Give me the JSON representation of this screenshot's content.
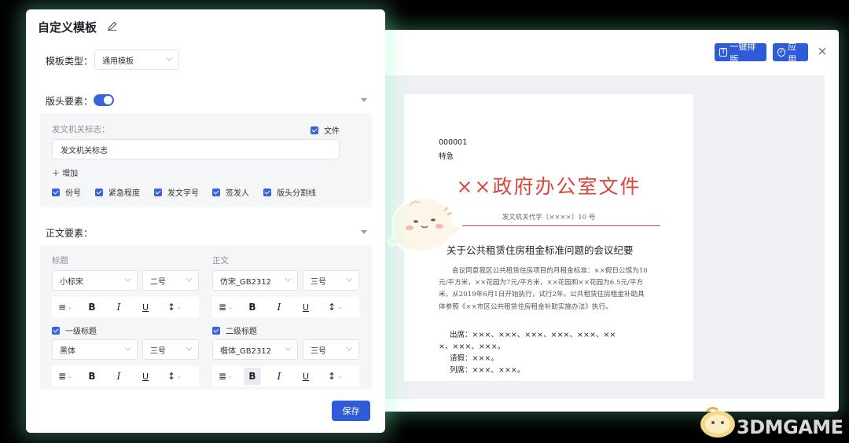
{
  "preview": {
    "auto_layout_label": "一键排版",
    "apply_label": "应用",
    "close_glyph": "×",
    "document": {
      "number": "000001",
      "urgency": "特急",
      "title": "××政府办公室文件",
      "reference": "发文机关代字〔××××〕10 号",
      "heading": "关于公共租赁住房租金标准问题的会议纪要",
      "body": "会议同意我区公共租赁住房项目的月租金标准：××假日公馆为10元/平方米，××花园为7元/平方米，××花园和××花园为6.5元/平方米，从2019年6月1日开始执行，试行2年。公共租赁住房租金补助具体参照《××市区公共租赁住房租金补助实施办法》执行。",
      "attend_line1": "出席：×××、×××、×××、×××、×××、××",
      "attend_line2": "×、×××、×××。",
      "leave_line": "请假：×××。",
      "observe_line": "列席：×××、×××。"
    }
  },
  "dialog": {
    "title": "自定义模板",
    "template_type_label": "模板类型：",
    "template_type_value": "通用模板",
    "header_section_label": "版头要素：",
    "header_toggle_on": true,
    "issuer_mark_label": "发文机关标志：",
    "issuer_mark_value": "发文机关标志",
    "file_checkbox_label": "文件",
    "add_label": "增加",
    "header_checks": [
      "份号",
      "紧急程度",
      "发文字号",
      "签发人",
      "版头分割线"
    ],
    "body_section_label": "正文要素：",
    "title_label": "标题",
    "title_font": "小标宋",
    "title_size": "二号",
    "text_label": "正文",
    "text_font": "仿宋_GB2312",
    "text_size": "三号",
    "level1_label": "一级标题",
    "level1_font": "黑体",
    "level1_size": "三号",
    "level2_label": "二级标题",
    "level2_font": "楷体_GB2312",
    "level2_size": "三号",
    "bold_glyph": "B",
    "italic_glyph": "I",
    "underline_glyph": "U",
    "save_label": "保存"
  },
  "watermark": {
    "text": "3DMGAME"
  },
  "colors": {
    "accent": "#2f5bd9",
    "doc_red": "#d9463f",
    "glow": "#78ffbe"
  }
}
